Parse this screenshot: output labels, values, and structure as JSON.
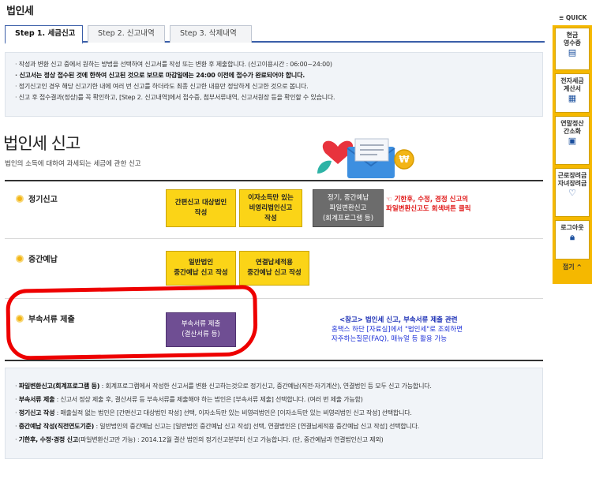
{
  "page": {
    "title": "법인세"
  },
  "tabs": [
    {
      "label": "Step 1. 세금신고"
    },
    {
      "label": "Step 2. 신고내역"
    },
    {
      "label": "Step 3. 삭제내역"
    }
  ],
  "notice": [
    "작성과 변환 신고 중에서 원하는 방법을 선택하여 신고서를 작성 또는 변환 후 제출합니다. (신고이용시간 : 06:00~24:00)",
    "신고서는 정상 접수된 것에 한하여 신고된 것으로 보므로 마감일에는 24:00 이전에 접수가 완료되어야 합니다.",
    "정기신고인 경우 해당 신고기한 내에 여러 번 신고를 하더라도 최종 신고한 내용만 정당하게 신고한 것으로 봅니다.",
    "신고 후 접수결과(정상)를 꼭 확인하고, [Step 2. 신고내역]에서 접수증, 첨부서류내역, 신고서원장 등을 확인할 수 있습니다."
  ],
  "section": {
    "title": "법인세 신고",
    "subtitle": "법인의 소득에 대하여 과세되는 세금에 관한 신고"
  },
  "rows": {
    "regular": {
      "label": "정기신고",
      "btn_simple": "간편신고 대상법인\n작성",
      "btn_nonprofit": "이자소득만 있는\n비영리법인신고\n작성",
      "btn_file": "정기, 중간예납\n파일변환신고\n(회계프로그램 등)"
    },
    "interim": {
      "label": "중간예납",
      "btn_general": "일반법인\n중간예납 신고 작성",
      "btn_consolidated": "연결납세적용\n중간예납 신고 작성"
    },
    "attach": {
      "label": "부속서류 제출",
      "btn_submit": "부속서류 제출\n(결산서류 등)"
    }
  },
  "red_note": "☜ 기한후, 수정, 경정 신고의\n   파일변환신고도 회색버튼 클릭",
  "reference": {
    "title": "<참고>  법인세 신고, 부속서류 제출 관련",
    "line1": "홈택스 하단 [자료실]에서 \"법인세\"로 조회하면",
    "line2": "자주하는질문(FAQ), 매뉴얼 등 활용 가능"
  },
  "footer": [
    {
      "bold": "파일변환신고(회계프로그램 등)",
      "text": " : 회계프로그램에서 작성한 신고서를 변환 신고하는것으로 정기신고, 중간예납(직전·자기계산), 연결법인 등 모두 신고 가능합니다."
    },
    {
      "bold": "부속서류 제출",
      "text": " : 신고서 정상 제출 후, 결산서류 등 부속서류를 제출해야 하는 법인은 [부속서류 제출] 선택합니다. (여러 번 제출 가능함)"
    },
    {
      "bold": "정기신고 작성",
      "text": " : 매출실적 없는 법인은 [간편신고 대상법인 작성] 선택, 이자소득만 있는 비영리법인은 [이자소득만 있는 비영리법인 신고 작성] 선택합니다."
    },
    {
      "bold": "중간예납 작성(직전연도기준)",
      "text": " : 일반법인의 중간예납 신고는 [일반법인 중간예납 신고 작성] 선택, 연결법인은 [연결납세적용 중간예납 신고 작성] 선택합니다."
    },
    {
      "bold": "기한후, 수정·경정 신고",
      "text": "(파일변환신고만 가능) : 2014.12월 결산 법인의 정기신고분부터 신고 가능합니다. (단, 중간예납과 연결법인신고 제외)"
    }
  ],
  "quick": {
    "title": "≡ QUICK",
    "items": [
      {
        "label": "현금\n영수증",
        "icon": "receipt-icon"
      },
      {
        "label": "전자세금\n계산서",
        "icon": "invoice-icon"
      },
      {
        "label": "연말정산\n간소화",
        "icon": "document-icon"
      },
      {
        "label": "근로장려금\n자녀장려금",
        "icon": "heart-icon"
      },
      {
        "label": "로그아웃",
        "icon": "lock-icon"
      }
    ],
    "close_label": "접기 ^"
  },
  "colors": {
    "tab_accent": "#3a5ea8",
    "yellow_button": "#fbd417",
    "gray_button": "#6c6c6c",
    "purple_button": "#6f4e93",
    "annotation_red": "#ee0000",
    "quick_bg": "#f5b800"
  }
}
